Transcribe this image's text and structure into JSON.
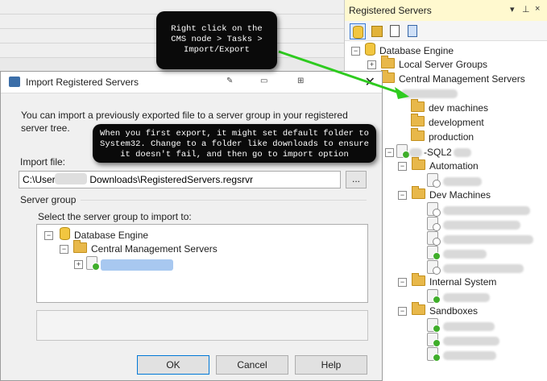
{
  "registered_servers": {
    "title": "Registered Servers",
    "controls": [
      "▾",
      "⊥",
      "×"
    ],
    "tree": {
      "root": "Database Engine",
      "local_group": "Local Server Groups",
      "cms": "Central Management Servers",
      "folders": [
        "dev machines",
        "development",
        "production"
      ],
      "server_suffix": "-SQL2",
      "groups": [
        "Automation",
        "Dev Machines",
        "Internal System",
        "Sandboxes"
      ]
    }
  },
  "callouts": {
    "cms_instructions": "Right click on the CMS node > Tasks > Import/Export",
    "export_note": "When you first export, it might set default folder to System32. Change to a folder like downloads to ensure it doesn't fail, and then go to import option"
  },
  "dialog": {
    "title": "Import Registered Servers",
    "intro": "You can import a previously exported file to a server group in your registered server tree.",
    "import_file_label": "Import file:",
    "import_file_value": "C:\\Users\\          Downloads\\RegisteredServers.regsrvr",
    "browse_label": "...",
    "server_group_label": "Server group",
    "select_label": "Select the server group to import to:",
    "tree": {
      "root": "Database Engine",
      "cms": "Central Management Servers"
    },
    "buttons": {
      "ok": "OK",
      "cancel": "Cancel",
      "help": "Help"
    }
  }
}
